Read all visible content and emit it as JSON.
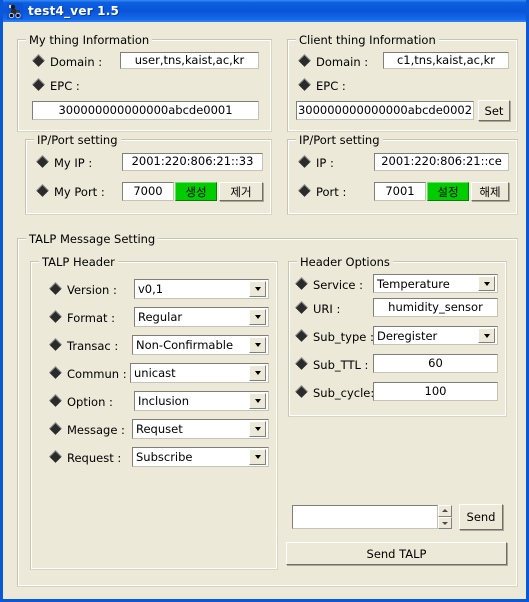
{
  "window": {
    "title": "test4_ver 1.5",
    "icon": "app-robot-icon",
    "titlebar_color": "#0a54d8",
    "background_color": "#ece9d8",
    "accent_green": "#00cc00"
  },
  "my_thing": {
    "group_title": "My thing Information",
    "domain_label": "Domain :",
    "domain_value": "user,tns,kaist,ac,kr",
    "epc_label": "EPC :",
    "epc_value": "300000000000000abcde0001",
    "ipport": {
      "group_title": "IP/Port setting",
      "ip_label": "My IP  :",
      "ip_value": "2001:220:806:21::33",
      "port_label": "My Port :",
      "port_value": "7000",
      "create_button": "생성",
      "remove_button": "제거"
    }
  },
  "client_thing": {
    "group_title": "Client thing Information",
    "domain_label": "Domain :",
    "domain_value": "c1,tns,kaist,ac,kr",
    "epc_label": "EPC :",
    "epc_value": "300000000000000abcde0002",
    "set_button": "Set",
    "ipport": {
      "group_title": "IP/Port setting",
      "ip_label": "IP :",
      "ip_value": "2001:220:806:21::ce",
      "port_label": "Port :",
      "port_value": "7001",
      "set_button": "설정",
      "release_button": "해제"
    }
  },
  "talp": {
    "group_title": "TALP Message Setting",
    "header": {
      "group_title": "TALP Header",
      "rows": [
        {
          "label": "Version :",
          "value": "v0,1"
        },
        {
          "label": "Format :",
          "value": "Regular"
        },
        {
          "label": "Transac :",
          "value": "Non-Confirmable"
        },
        {
          "label": "Commun :",
          "value": "unicast"
        },
        {
          "label": "Option :",
          "value": "Inclusion"
        },
        {
          "label": "Message :",
          "value": "Requset"
        },
        {
          "label": "Request :",
          "value": "Subscribe"
        }
      ]
    },
    "options": {
      "group_title": "Header Options",
      "service_label": "Service :",
      "service_value": "Temperature",
      "uri_label": "URI :",
      "uri_value": "humidity_sensor",
      "sub_type_label": "Sub_type :",
      "sub_type_value": "Deregister",
      "sub_ttl_label": "Sub_TTL :",
      "sub_ttl_value": "60",
      "sub_cycle_label": "Sub_cycle:",
      "sub_cycle_value": "100"
    },
    "send_field_value": "",
    "send_button": "Send",
    "send_talp_button": "Send TALP"
  }
}
